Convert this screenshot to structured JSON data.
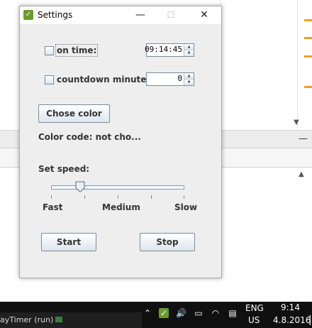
{
  "window": {
    "title": "Settings",
    "minimize_glyph": "—",
    "maximize_glyph": "☐",
    "close_glyph": "✕"
  },
  "on_time": {
    "label": "on time:",
    "checked": false,
    "value": "09:14:45"
  },
  "countdown": {
    "label": "countdown minutes:",
    "checked": false,
    "value": "0"
  },
  "color": {
    "button_label": "Chose color",
    "code_text": "Color code: not cho..."
  },
  "speed": {
    "label": "Set speed:",
    "ticks": [
      "Fast",
      "Medium",
      "Slow"
    ],
    "value_fraction": 0.22
  },
  "actions": {
    "start_label": "Start",
    "stop_label": "Stop"
  },
  "background": {
    "status_text": "ayTimer (run)",
    "accent_marks": "#f0a020"
  },
  "taskbar": {
    "language_top": "ENG",
    "language_bottom": "US",
    "time": "9:14",
    "date": "4.8.2016"
  }
}
